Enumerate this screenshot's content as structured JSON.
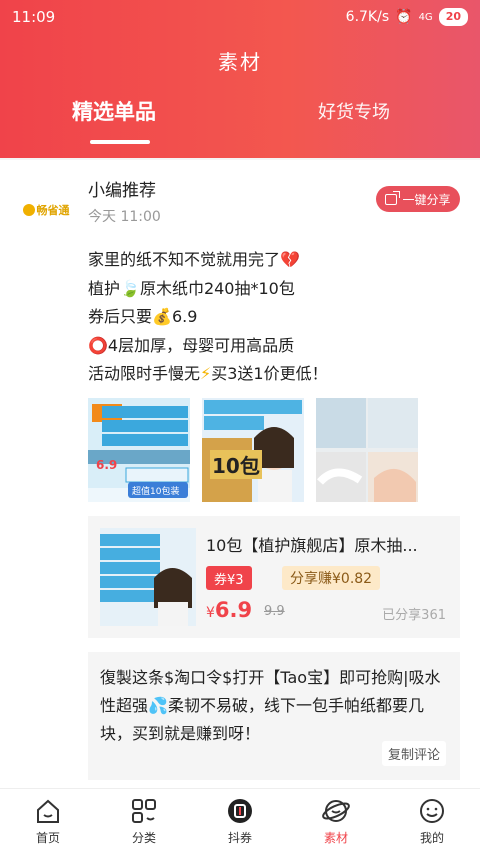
{
  "status": {
    "time": "11:09",
    "signal": "...",
    "speed": "6.7K/s",
    "network": "4G",
    "battery": "20"
  },
  "header": {
    "title": "素材",
    "tabs": [
      {
        "label": "精选单品"
      },
      {
        "label": "好货专场"
      }
    ]
  },
  "post": {
    "avatar_text": "畅省通",
    "author": "小编推荐",
    "time": "今天 11:00",
    "share_label": "一键分享",
    "lines": [
      "家里的纸不知不觉就用完了",
      "植护",
      "原木纸巾240抽*10包",
      "券后只要",
      "6.9",
      "4层加厚，母婴可用高品质",
      "活动限时手慢无",
      "买3送1价更低！"
    ],
    "img1_badge": "10包",
    "img0_tag": "超值10包装",
    "img0_price": "6.9"
  },
  "product": {
    "title": "10包【植护旗舰店】原木抽...",
    "coupon": "券¥3",
    "earn": "分享赚¥0.82",
    "price_symbol": "¥",
    "price": "6.9",
    "original": "9.9",
    "shared": "已分享361"
  },
  "copy": {
    "text": "復製这条$淘口令$打开【Tao宝】即可抢购|吸水性超强",
    "text2": "柔韧不易破，线下一包手帕纸都要几块，买到就是赚到呀！",
    "button": "复制评论"
  },
  "tabbar": [
    {
      "label": "首页",
      "icon": "home-icon"
    },
    {
      "label": "分类",
      "icon": "category-icon"
    },
    {
      "label": "抖券",
      "icon": "douquan-icon"
    },
    {
      "label": "素材",
      "icon": "material-icon",
      "active": true
    },
    {
      "label": "我的",
      "icon": "profile-icon"
    }
  ],
  "colors": {
    "brand": "#f0434a",
    "earn_bg": "#fde9c8"
  }
}
